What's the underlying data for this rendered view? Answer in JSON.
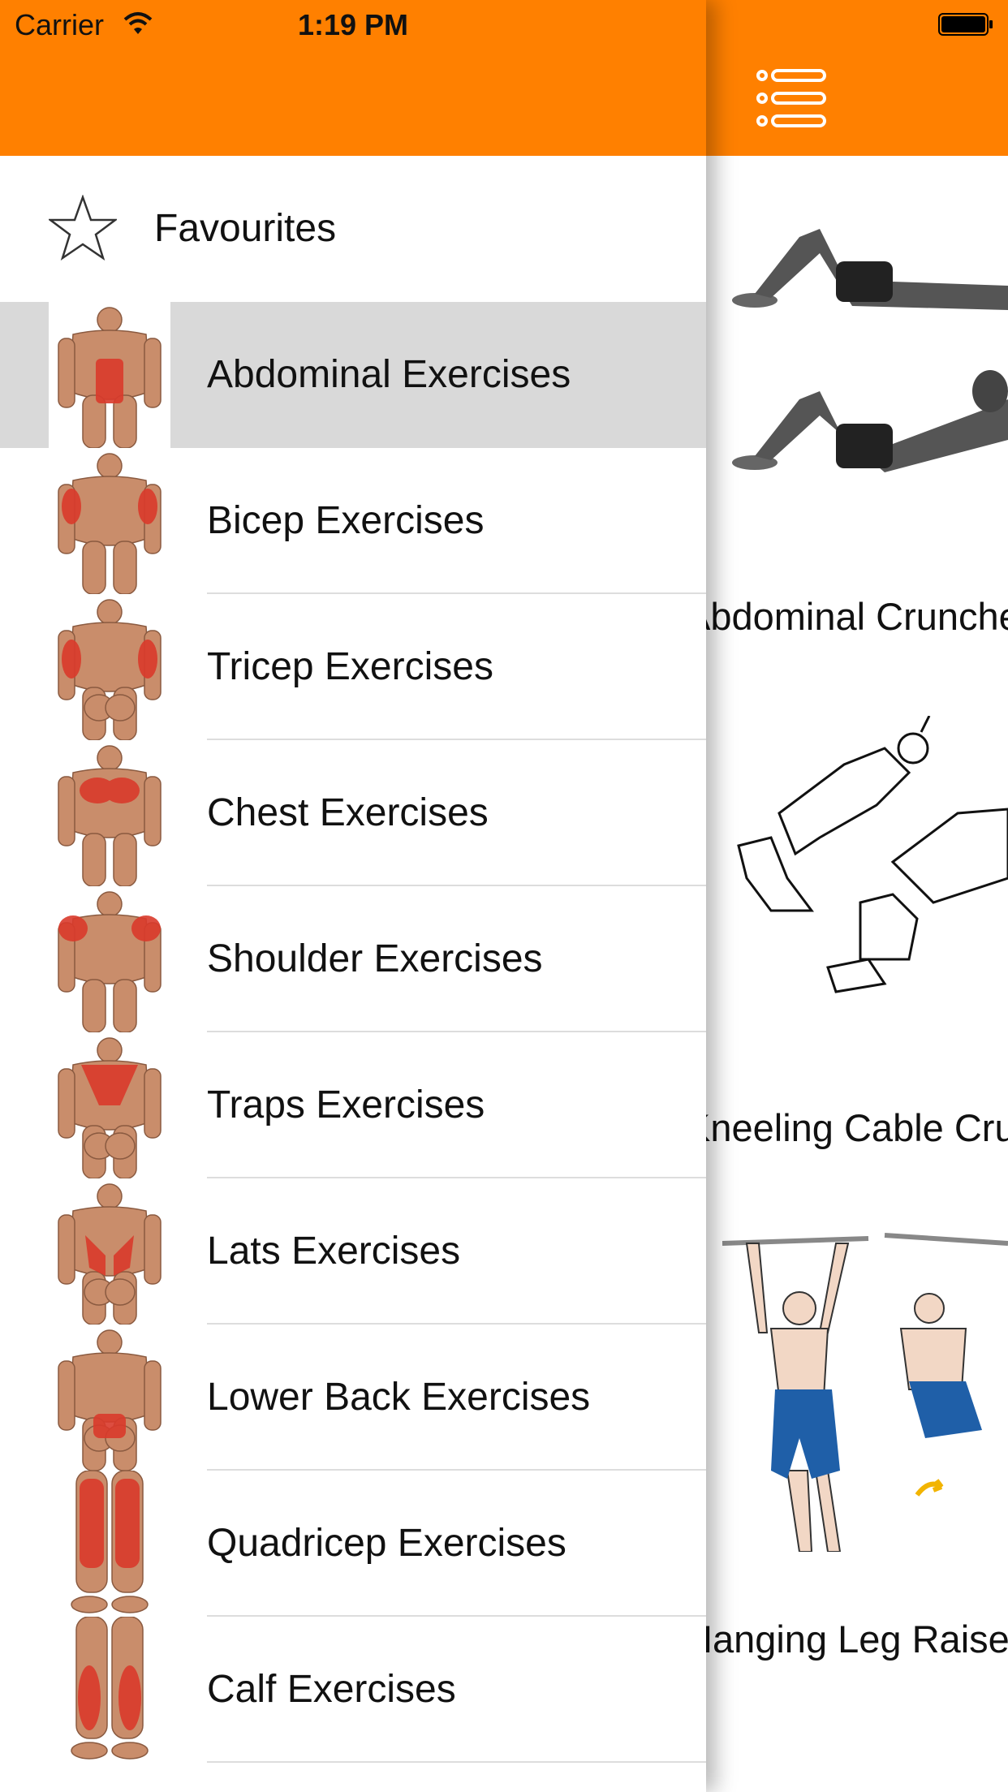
{
  "status_bar": {
    "carrier": "Carrier",
    "time": "1:19 PM"
  },
  "menu": {
    "favourites_label": "Favourites",
    "items": [
      {
        "label": "Abdominal Exercises",
        "selected": true
      },
      {
        "label": "Bicep Exercises"
      },
      {
        "label": "Tricep Exercises"
      },
      {
        "label": "Chest Exercises"
      },
      {
        "label": "Shoulder Exercises"
      },
      {
        "label": "Traps Exercises"
      },
      {
        "label": "Lats Exercises"
      },
      {
        "label": "Lower Back Exercises"
      },
      {
        "label": "Quadricep Exercises"
      },
      {
        "label": "Calf Exercises"
      }
    ]
  },
  "content": {
    "exercises": [
      {
        "title": "Abdominal Crunches"
      },
      {
        "title": "Kneeling Cable Crunch"
      },
      {
        "title": "Hanging Leg Raise"
      }
    ]
  },
  "colors": {
    "accent": "#FF8000",
    "selected_row": "#D9D9D9",
    "muscle_highlight": "#D93A2B"
  },
  "icons": {
    "favourites": "star-outline-icon",
    "menu": "menu-list-icon",
    "wifi": "wifi-icon",
    "battery": "battery-icon"
  }
}
